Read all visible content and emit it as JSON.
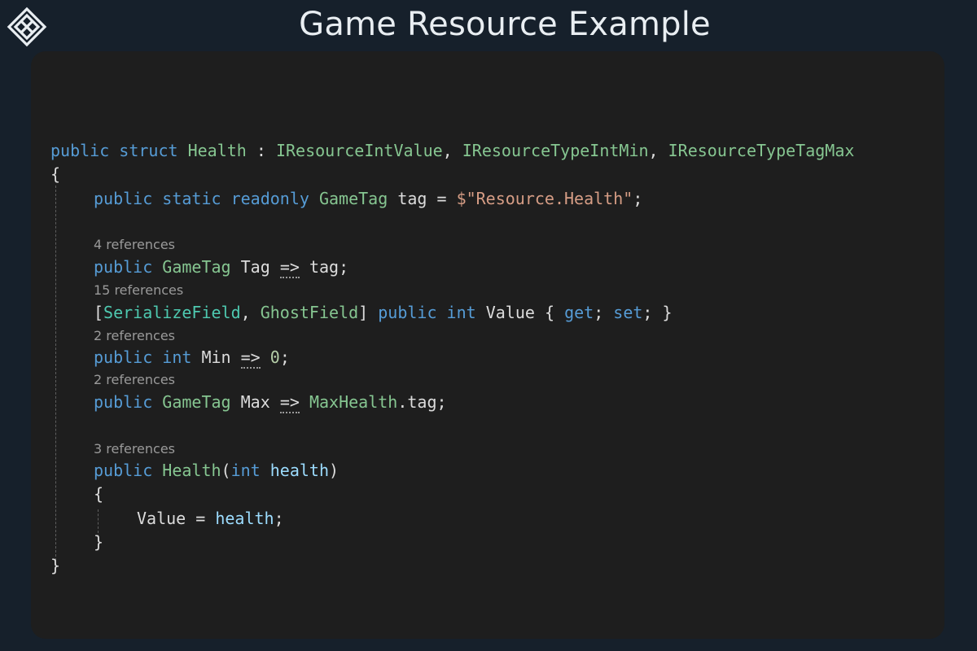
{
  "header": {
    "title": "Game Resource Example",
    "logo_icon": "diamond-knot-logo"
  },
  "code": {
    "line1": {
      "t1": "public",
      "t2": "struct",
      "t3": "Health",
      "t4": " : ",
      "t5": "IResourceIntValue",
      "t6": ", ",
      "t7": "IResourceTypeIntMin",
      "t8": ", ",
      "t9": "IResourceTypeTagMax"
    },
    "line2": {
      "t1": "{"
    },
    "line3": {
      "t1": "public",
      "t2": "static",
      "t3": "readonly",
      "t4": "GameTag",
      "t5": "tag",
      "t6": " = ",
      "t7": "$\"Resource.Health\"",
      "t8": ";"
    },
    "ref1": "4 references",
    "line4": {
      "t1": "public",
      "t2": "GameTag",
      "t3": "Tag",
      "t4": "=>",
      "t5": "tag",
      "t6": ";"
    },
    "ref2": "15 references",
    "line5": {
      "t1": "[",
      "t2": "SerializeField",
      "t3": ", ",
      "t4": "GhostField",
      "t5": "]",
      "t6": "public",
      "t7": "int",
      "t8": "Value",
      "t9": "{",
      "t10": "get",
      "t11": ";",
      "t12": "set",
      "t13": ";",
      "t14": "}"
    },
    "ref3": "2 references",
    "line6": {
      "t1": "public",
      "t2": "int",
      "t3": "Min",
      "t4": "=>",
      "t5": "0",
      "t6": ";"
    },
    "ref4": "2 references",
    "line7": {
      "t1": "public",
      "t2": "GameTag",
      "t3": "Max",
      "t4": "=>",
      "t5": "MaxHealth",
      "t6": ".tag",
      "t7": ";"
    },
    "ref5": "3 references",
    "line8": {
      "t1": "public",
      "t2": "Health",
      "t3": "(",
      "t4": "int",
      "t5": "health",
      "t6": ")"
    },
    "line9": {
      "t1": "{"
    },
    "line10": {
      "t1": "Value",
      "t2": " = ",
      "t3": "health",
      "t4": ";"
    },
    "line11": {
      "t1": "}"
    },
    "line12": {
      "t1": "}"
    }
  },
  "colors": {
    "page_background": "#16202b",
    "editor_background": "#1e1e1e",
    "keyword": "#569cd6",
    "type": "#4ec9b0",
    "struct_type": "#86c691",
    "string": "#d69d85",
    "number": "#b5cea8",
    "parameter": "#9cdcfe",
    "text": "#dcdcdc",
    "codelens": "#9a9a9a"
  }
}
